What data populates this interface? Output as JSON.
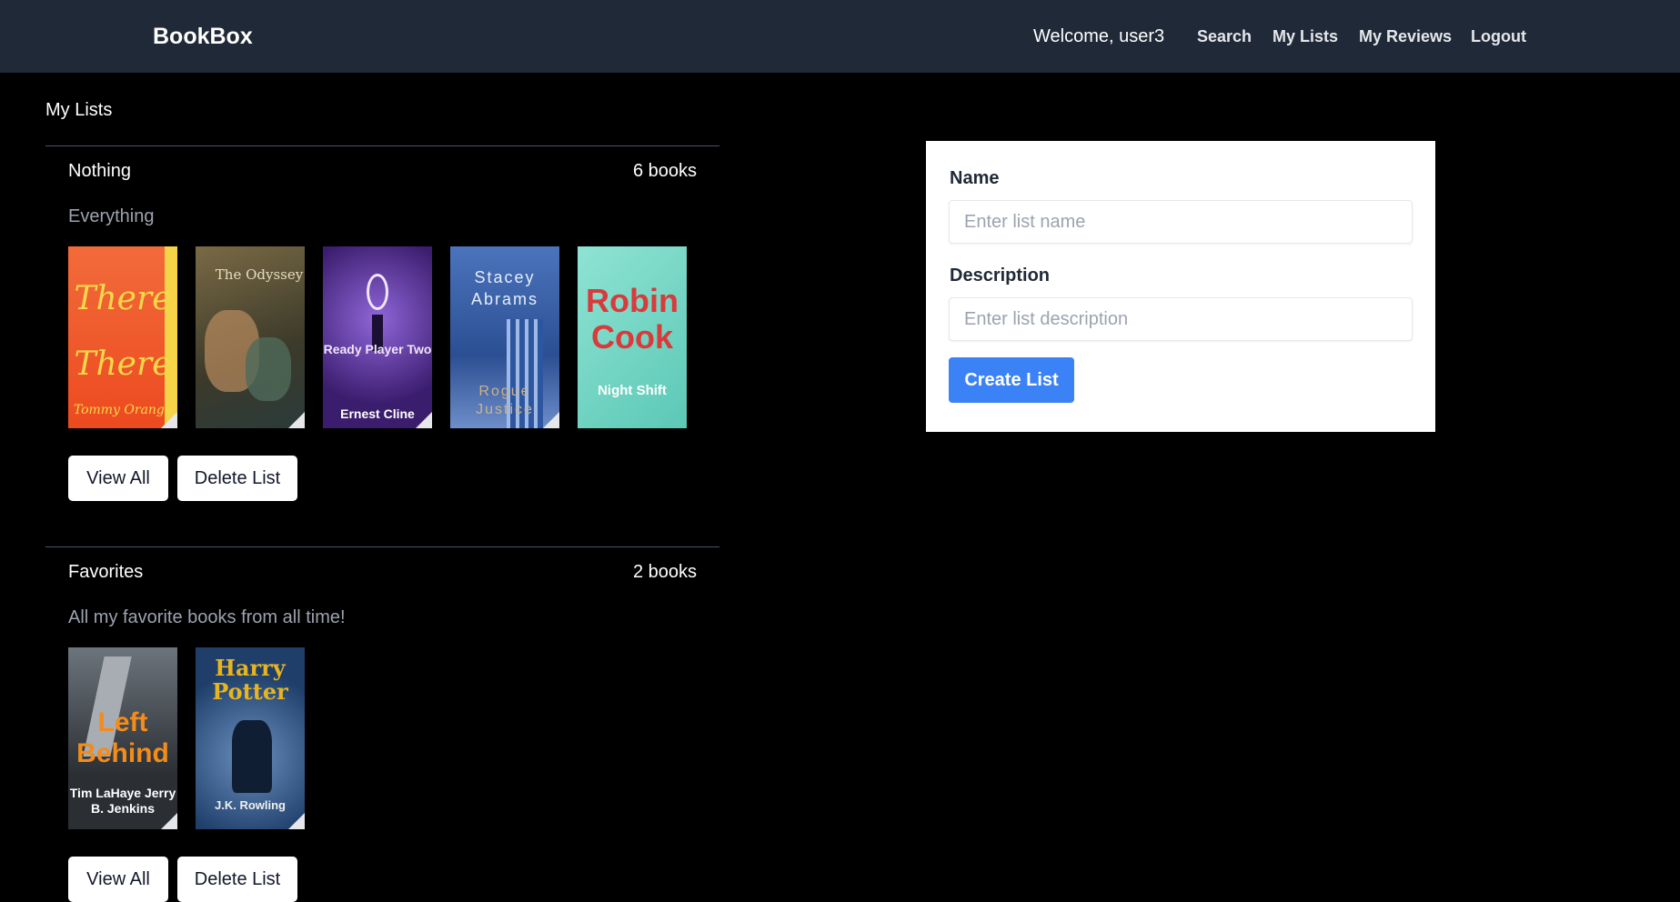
{
  "navbar": {
    "brand": "BookBox",
    "welcome": "Welcome, user3",
    "links": [
      "Search",
      "My Lists",
      "My Reviews",
      "Logout"
    ]
  },
  "page": {
    "heading": "My Lists"
  },
  "lists": [
    {
      "name": "Nothing",
      "count": "6 books",
      "description": "Everything",
      "covers": [
        {
          "title": "There There",
          "author": "Tommy Orange",
          "color": "#f15a2b"
        },
        {
          "title": "The Odyssey",
          "author": "",
          "color": "#5b4a2d"
        },
        {
          "title": "Ready Player Two",
          "author": "Ernest Cline",
          "color": "#3b1d6e"
        },
        {
          "title": "Rogue Justice",
          "author": "Stacey Abrams",
          "color": "#3c63a8"
        },
        {
          "title": "Night Shift",
          "author": "Robin Cook",
          "color": "#6fd3c3"
        }
      ],
      "view_label": "View All",
      "delete_label": "Delete List"
    },
    {
      "name": "Favorites",
      "count": "2 books",
      "description": "All my favorite books from all time!",
      "covers": [
        {
          "title": "Left Behind",
          "author": "Tim LaHaye Jerry B. Jenkins",
          "color": "#3a3f45"
        },
        {
          "title": "Harry Potter",
          "author": "J.K. Rowling",
          "color": "#2c5a86"
        }
      ],
      "view_label": "View All",
      "delete_label": "Delete List"
    }
  ],
  "form": {
    "name_label": "Name",
    "name_placeholder": "Enter list name",
    "description_label": "Description",
    "description_placeholder": "Enter list description",
    "submit_label": "Create List"
  },
  "colors": {
    "navbar": "#1f2937",
    "background": "#000000",
    "primary": "#3b82f6"
  }
}
